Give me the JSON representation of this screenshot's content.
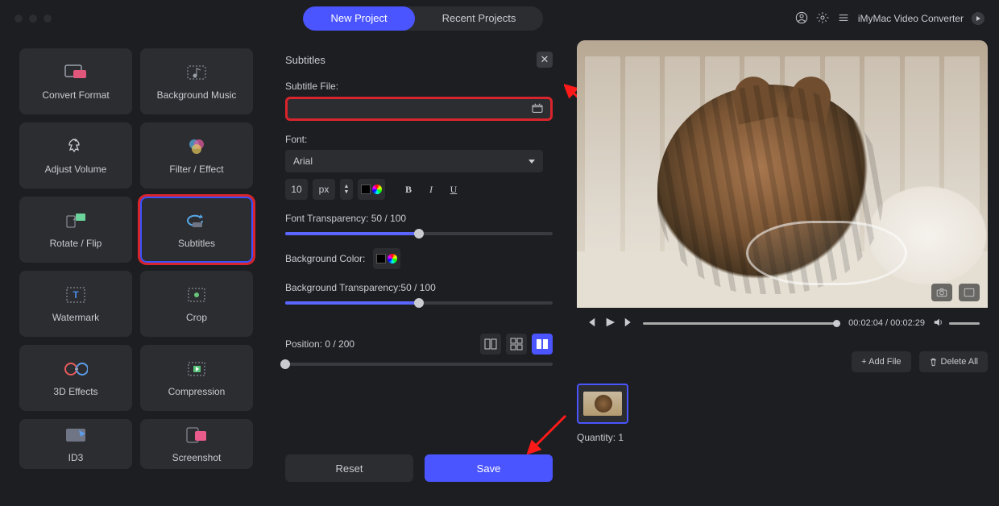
{
  "titlebar": {
    "tab_new": "New Project",
    "tab_recent": "Recent Projects",
    "app_name": "iMyMac Video Converter"
  },
  "sidebar": {
    "tools": [
      {
        "label": "Convert Format",
        "icon": "convert-icon"
      },
      {
        "label": "Background Music",
        "icon": "music-icon"
      },
      {
        "label": "Adjust Volume",
        "icon": "volume-icon"
      },
      {
        "label": "Filter / Effect",
        "icon": "filter-icon"
      },
      {
        "label": "Rotate / Flip",
        "icon": "rotate-icon"
      },
      {
        "label": "Subtitles",
        "icon": "subtitles-icon",
        "selected": true
      },
      {
        "label": "Watermark",
        "icon": "watermark-icon"
      },
      {
        "label": "Crop",
        "icon": "crop-icon"
      },
      {
        "label": "3D Effects",
        "icon": "3d-icon"
      },
      {
        "label": "Compression",
        "icon": "compress-icon"
      },
      {
        "label": "ID3",
        "icon": "id3-icon"
      },
      {
        "label": "Screenshot",
        "icon": "screenshot-icon"
      }
    ]
  },
  "panel": {
    "title": "Subtitles",
    "subtitle_file_label": "Subtitle File:",
    "subtitle_file_value": "",
    "font_label": "Font:",
    "font_value": "Arial",
    "font_size": "10",
    "font_unit": "px",
    "bold": "B",
    "italic": "I",
    "underline": "U",
    "font_trans_label": "Font Transparency: 50 / 100",
    "font_trans_percent": 50,
    "bgcolor_label": "Background Color:",
    "bg_trans_label": "Background Transparency:50 / 100",
    "bg_trans_percent": 50,
    "position_label": "Position: 0 / 200",
    "position_percent": 0,
    "reset": "Reset",
    "save": "Save"
  },
  "preview": {
    "time_current": "00:02:04",
    "time_total": "00:02:29",
    "add_file": "+ Add File",
    "delete_all": "Delete All",
    "quantity_label": "Quantity: 1"
  }
}
